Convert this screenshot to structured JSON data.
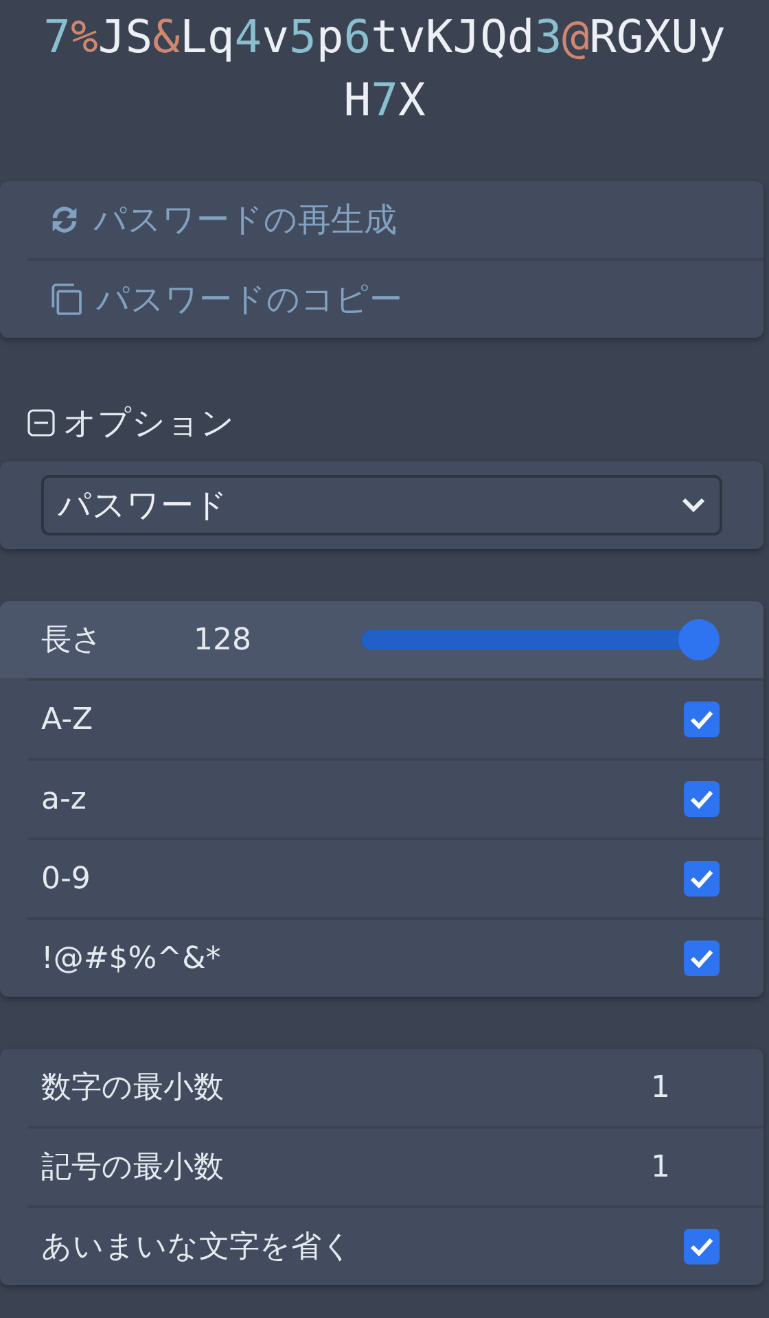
{
  "password": [
    {
      "text": "7",
      "kind": "digit"
    },
    {
      "text": "%",
      "kind": "symbol"
    },
    {
      "text": "JS",
      "kind": "letter"
    },
    {
      "text": "&",
      "kind": "symbol"
    },
    {
      "text": "Lq",
      "kind": "letter"
    },
    {
      "text": "4",
      "kind": "digit"
    },
    {
      "text": "v",
      "kind": "letter"
    },
    {
      "text": "5",
      "kind": "digit"
    },
    {
      "text": "p",
      "kind": "letter"
    },
    {
      "text": "6",
      "kind": "digit"
    },
    {
      "text": "tvKJQd",
      "kind": "letter"
    },
    {
      "text": "3",
      "kind": "digit"
    },
    {
      "text": "@",
      "kind": "symbol"
    },
    {
      "text": "RGXUyH",
      "kind": "letter"
    },
    {
      "text": "7",
      "kind": "digit"
    },
    {
      "text": "X",
      "kind": "letter"
    }
  ],
  "actions": [
    {
      "label": "パスワードの再生成",
      "kind": "regenerate"
    },
    {
      "label": "パスワードのコピー",
      "kind": "copy"
    }
  ],
  "options": {
    "title": "オプション",
    "expanded": true,
    "type": "パスワード"
  },
  "length": {
    "label": "長さ",
    "value": "128",
    "level": 1.0
  },
  "charsets": [
    {
      "label": "A-Z",
      "checked": true
    },
    {
      "label": "a-z",
      "checked": true
    },
    {
      "label": "0-9",
      "checked": true
    },
    {
      "label": "!@#$%^&*",
      "checked": true
    }
  ],
  "advanced": [
    {
      "kind": "number",
      "label": "数字の最小数",
      "value": "1"
    },
    {
      "kind": "number",
      "label": "記号の最小数",
      "value": "1"
    },
    {
      "kind": "check",
      "label": "あいまいな文字を省く",
      "checked": true
    }
  ]
}
